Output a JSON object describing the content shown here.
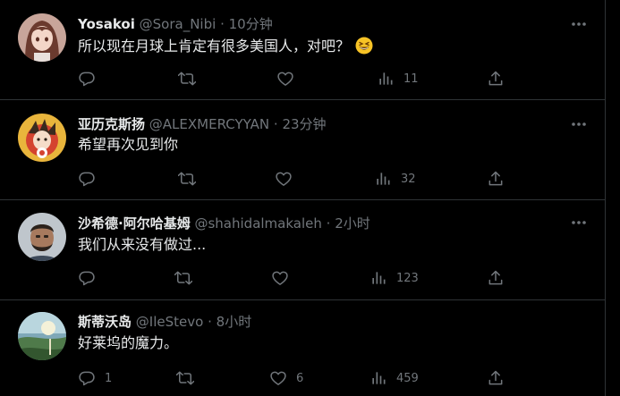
{
  "colors": {
    "background": "#000000",
    "text_primary": "#e7e9ea",
    "text_secondary": "#71767b",
    "divider": "#2f3336"
  },
  "tweets": [
    {
      "display_name": "Yosakoi",
      "handle": "@Sora_Nibi",
      "separator": "·",
      "time": "10分钟",
      "text": "所以现在月球上肯定有很多美国人，对吧？",
      "emoji": "grinning-squinting-face",
      "reply_count": "",
      "retweet_count": "",
      "like_count": "",
      "view_count": "11"
    },
    {
      "display_name": "亚历克斯扬",
      "handle": "@ALEXMERCYYAN",
      "separator": "·",
      "time": "23分钟",
      "text": "希望再次见到你",
      "reply_count": "",
      "retweet_count": "",
      "like_count": "",
      "view_count": "32"
    },
    {
      "display_name": "沙希德·阿尔哈基姆",
      "handle": "@shahidalmakaleh",
      "separator": "·",
      "time": "2小时",
      "text": "我们从来没有做过...",
      "reply_count": "",
      "retweet_count": "",
      "like_count": "",
      "view_count": "123"
    },
    {
      "display_name": "斯蒂沃岛",
      "handle": "@IleStevo",
      "separator": "·",
      "time": "8小时",
      "text": "好莱坞的魔力。",
      "reply_count": "1",
      "retweet_count": "",
      "like_count": "6",
      "view_count": "459"
    }
  ]
}
